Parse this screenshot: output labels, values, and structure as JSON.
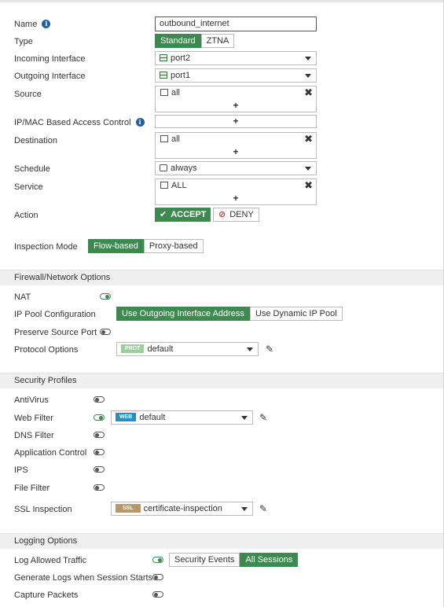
{
  "colors": {
    "accent": "#3c8a4f",
    "deny": "#d32f2f",
    "info": "#1f5fa6",
    "prot_badge": "#9ccf9c",
    "web_badge": "#2b8fb5",
    "ssl_badge": "#b8986a"
  },
  "form": {
    "name": {
      "label": "Name",
      "value": "outbound_internet",
      "info_icon": "info-icon"
    },
    "type": {
      "label": "Type",
      "options": [
        "Standard",
        "ZTNA"
      ],
      "selected": "Standard"
    },
    "incoming": {
      "label": "Incoming Interface",
      "value": "port2",
      "icon": "port-icon"
    },
    "outgoing": {
      "label": "Outgoing Interface",
      "value": "port1",
      "icon": "port-icon"
    },
    "source": {
      "label": "Source",
      "value": "all",
      "icon": "address-icon",
      "add": "+",
      "remove": "✖"
    },
    "ipmac": {
      "label": "IP/MAC Based Access Control",
      "add": "+"
    },
    "destination": {
      "label": "Destination",
      "value": "all",
      "icon": "address-icon",
      "add": "+",
      "remove": "✖"
    },
    "schedule": {
      "label": "Schedule",
      "value": "always",
      "icon": "schedule-icon"
    },
    "service": {
      "label": "Service",
      "value": "ALL",
      "icon": "service-icon",
      "add": "+",
      "remove": "✖"
    },
    "action": {
      "label": "Action",
      "accept": "ACCEPT",
      "deny": "DENY",
      "selected": "ACCEPT"
    },
    "inspection": {
      "label": "Inspection Mode",
      "options": [
        "Flow-based",
        "Proxy-based"
      ],
      "selected": "Flow-based"
    }
  },
  "firewall": {
    "title": "Firewall/Network Options",
    "nat": {
      "label": "NAT",
      "enabled": true
    },
    "ippool": {
      "label": "IP Pool Configuration",
      "options": [
        "Use Outgoing Interface Address",
        "Use Dynamic IP Pool"
      ],
      "selected": "Use Outgoing Interface Address"
    },
    "preserve": {
      "label": "Preserve Source Port",
      "enabled": false
    },
    "protocol": {
      "label": "Protocol Options",
      "badge": "PROT",
      "value": "default"
    }
  },
  "security": {
    "title": "Security Profiles",
    "antivirus": {
      "label": "AntiVirus",
      "enabled": false
    },
    "webfilter": {
      "label": "Web Filter",
      "enabled": true,
      "badge": "WEB",
      "value": "default"
    },
    "dnsfilter": {
      "label": "DNS Filter",
      "enabled": false
    },
    "appcontrol": {
      "label": "Application Control",
      "enabled": false
    },
    "ips": {
      "label": "IPS",
      "enabled": false
    },
    "filefilter": {
      "label": "File Filter",
      "enabled": false
    },
    "ssl": {
      "label": "SSL Inspection",
      "badge": "SSL",
      "value": "certificate-inspection"
    }
  },
  "logging": {
    "title": "Logging Options",
    "allowed": {
      "label": "Log Allowed Traffic",
      "enabled": true,
      "options": [
        "Security Events",
        "All Sessions"
      ],
      "selected": "All Sessions"
    },
    "sessionstart": {
      "label": "Generate Logs when Session Starts",
      "enabled": false
    },
    "capture": {
      "label": "Capture Packets",
      "enabled": false
    }
  }
}
